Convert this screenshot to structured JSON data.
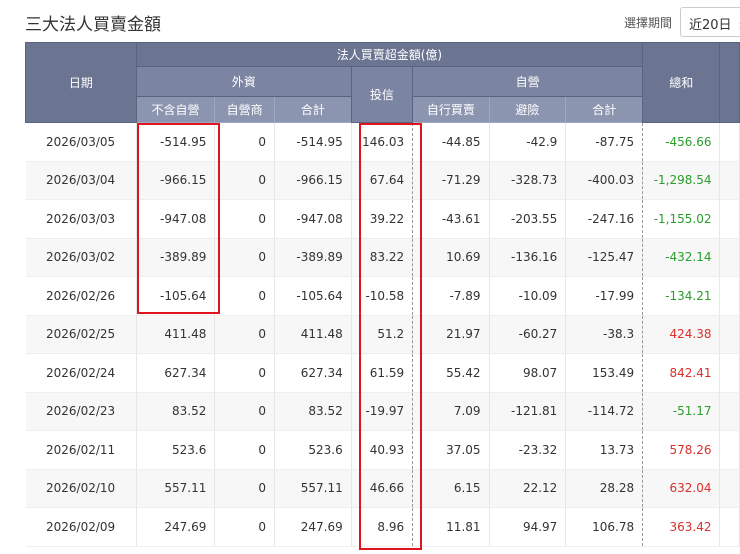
{
  "title": "三大法人買賣金額",
  "period": {
    "label": "選擇期間",
    "value": "近20日"
  },
  "header": {
    "date": "日期",
    "group": "法人買賣超金額(億)",
    "foreign": "外資",
    "foreign_ex": "不含自營",
    "foreign_dealer": "自營商",
    "foreign_total": "合計",
    "trust": "投信",
    "dealer": "自營",
    "dealer_self": "自行買賣",
    "dealer_hedge": "避險",
    "dealer_total": "合計",
    "sum": "總和"
  },
  "colors": {
    "positive": "#d9302c",
    "negative": "#2a9d2a"
  },
  "rows": [
    [
      "2026/03/05",
      "-514.95",
      "0",
      "-514.95",
      "146.03",
      "-44.85",
      "-42.9",
      "-87.75",
      "-456.66"
    ],
    [
      "2026/03/04",
      "-966.15",
      "0",
      "-966.15",
      "67.64",
      "-71.29",
      "-328.73",
      "-400.03",
      "-1,298.54"
    ],
    [
      "2026/03/03",
      "-947.08",
      "0",
      "-947.08",
      "39.22",
      "-43.61",
      "-203.55",
      "-247.16",
      "-1,155.02"
    ],
    [
      "2026/03/02",
      "-389.89",
      "0",
      "-389.89",
      "83.22",
      "10.69",
      "-136.16",
      "-125.47",
      "-432.14"
    ],
    [
      "2026/02/26",
      "-105.64",
      "0",
      "-105.64",
      "-10.58",
      "-7.89",
      "-10.09",
      "-17.99",
      "-134.21"
    ],
    [
      "2026/02/25",
      "411.48",
      "0",
      "411.48",
      "51.2",
      "21.97",
      "-60.27",
      "-38.3",
      "424.38"
    ],
    [
      "2026/02/24",
      "627.34",
      "0",
      "627.34",
      "61.59",
      "55.42",
      "98.07",
      "153.49",
      "842.41"
    ],
    [
      "2026/02/23",
      "83.52",
      "0",
      "83.52",
      "-19.97",
      "7.09",
      "-121.81",
      "-114.72",
      "-51.17"
    ],
    [
      "2026/02/11",
      "523.6",
      "0",
      "523.6",
      "40.93",
      "37.05",
      "-23.32",
      "13.73",
      "578.26"
    ],
    [
      "2026/02/10",
      "557.11",
      "0",
      "557.11",
      "46.66",
      "6.15",
      "22.12",
      "28.28",
      "632.04"
    ],
    [
      "2026/02/09",
      "247.69",
      "0",
      "247.69",
      "8.96",
      "11.81",
      "94.97",
      "106.78",
      "363.42"
    ]
  ]
}
